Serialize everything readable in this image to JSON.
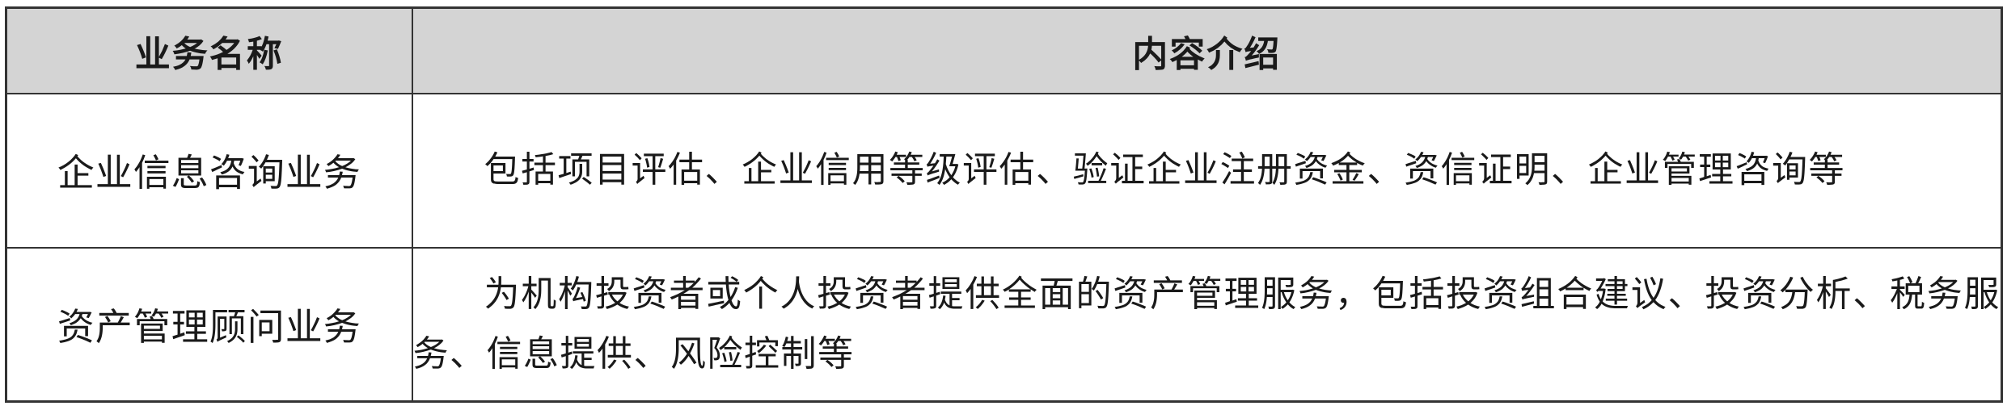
{
  "table": {
    "headers": {
      "name": "业务名称",
      "description": "内容介绍"
    },
    "rows": [
      {
        "name": "企业信息咨询业务",
        "description": "包括项目评估、企业信用等级评估、验证企业注册资金、资信证明、企业管理咨询等"
      },
      {
        "name": "资产管理顾问业务",
        "description": "为机构投资者或个人投资者提供全面的资产管理服务，包括投资组合建议、投资分析、税务服务、信息提供、风险控制等"
      }
    ]
  },
  "colors": {
    "header_background": "#d4d4d4",
    "border": "#333333",
    "text": "#1a1a1a"
  }
}
